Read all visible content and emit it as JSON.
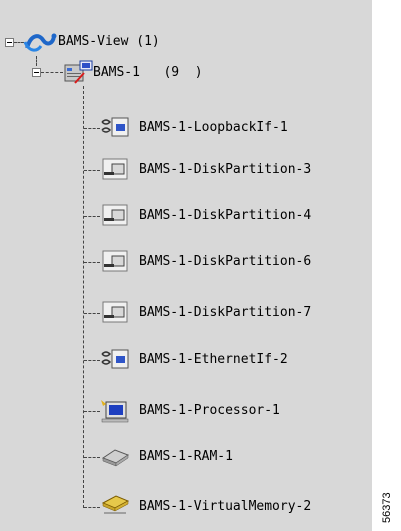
{
  "tree": {
    "root": {
      "label": "BAMS-View (1)"
    },
    "host": {
      "label": "BAMS-1   (9  )"
    },
    "children": [
      {
        "label": "BAMS-1-LoopbackIf-1",
        "icon": "loopback-interface-icon"
      },
      {
        "label": "BAMS-1-DiskPartition-3",
        "icon": "disk-partition-icon"
      },
      {
        "label": "BAMS-1-DiskPartition-4",
        "icon": "disk-partition-icon"
      },
      {
        "label": "BAMS-1-DiskPartition-6",
        "icon": "disk-partition-icon"
      },
      {
        "label": "BAMS-1-DiskPartition-7",
        "icon": "disk-partition-icon"
      },
      {
        "label": "BAMS-1-EthernetIf-2",
        "icon": "ethernet-interface-icon"
      },
      {
        "label": "BAMS-1-Processor-1",
        "icon": "processor-icon"
      },
      {
        "label": "BAMS-1-RAM-1",
        "icon": "ram-chip-icon"
      },
      {
        "label": "BAMS-1-VirtualMemory-2",
        "icon": "virtual-memory-icon"
      }
    ]
  },
  "figure_id": "56373",
  "colors": {
    "pane_bg": "#d8d8d8",
    "text": "#000000"
  }
}
